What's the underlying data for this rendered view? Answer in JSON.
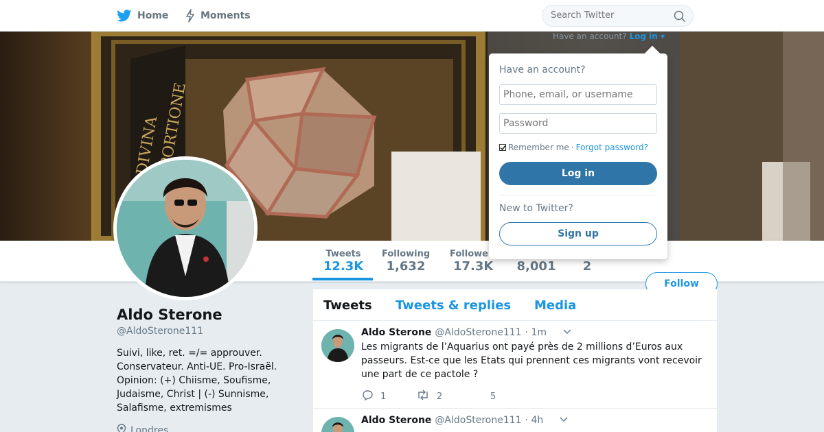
{
  "nav": {
    "home_label": "Home",
    "moments_label": "Moments",
    "search_placeholder": "Search Twitter",
    "login_hint_text": "Have an account?",
    "login_hint_link": "Log in ▾"
  },
  "stats": [
    {
      "label": "Tweets",
      "value": "12.3K"
    },
    {
      "label": "Following",
      "value": "1,632"
    },
    {
      "label": "Followers",
      "value": "17.3K"
    },
    {
      "label": "",
      "value": "8,001"
    },
    {
      "label": "",
      "value": "2"
    }
  ],
  "follow_label": "Follow",
  "profile": {
    "name": "Aldo Sterone",
    "handle": "@AldoSterone111",
    "bio": "Suivi, like, ret. =/= approuver. Conservateur. Anti-UE. Pro-Israël. Opinion: (+) Chiisme, Soufisme, Judaisme, Christ | (-) Sunnisme, Salafisme, extremismes",
    "location": "Londres"
  },
  "timeline": {
    "tabs": [
      "Tweets",
      "Tweets & replies",
      "Media"
    ],
    "tweets": [
      {
        "name": "Aldo Sterone",
        "handle": "@AldoSterone111",
        "time": "· 1m",
        "text": "Les migrants de l’Aquarius ont payé près de 2 millions d’Euros aux passeurs. Est-ce que les Etats qui prennent ces migrants vont recevoir une part de ce pactole ?",
        "replies": "1",
        "retweets": "2",
        "likes": "5"
      },
      {
        "name": "Aldo Sterone",
        "handle": "@AldoSterone111",
        "time": "· 4h"
      }
    ]
  },
  "login": {
    "title": "Have an account?",
    "username_placeholder": "Phone, email, or username",
    "password_placeholder": "Password",
    "remember": "Remember me",
    "separator": "·",
    "forgot": "Forgot password?",
    "login_button": "Log in",
    "new_text": "New to Twitter?",
    "signup_button": "Sign up"
  },
  "colors": {
    "accent": "#1b95e0",
    "button_dark": "#2f75a8",
    "background": "#e6ecf0"
  }
}
